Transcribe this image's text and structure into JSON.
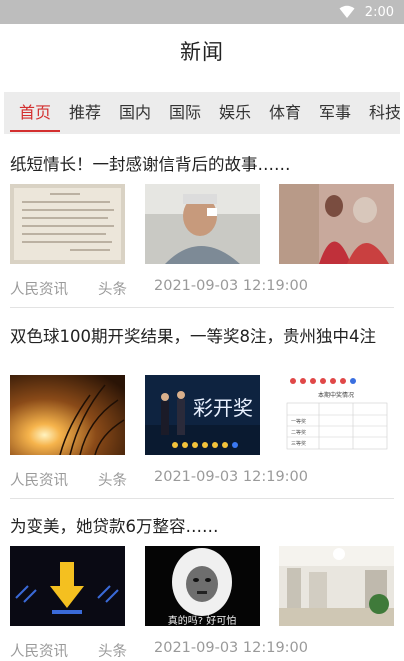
{
  "status_bar": {
    "time": "2:00"
  },
  "header": {
    "title": "新闻"
  },
  "tabs": [
    {
      "label": "首页"
    },
    {
      "label": "推荐"
    },
    {
      "label": "国内"
    },
    {
      "label": "国际"
    },
    {
      "label": "娱乐"
    },
    {
      "label": "体育"
    },
    {
      "label": "军事"
    },
    {
      "label": "科技"
    }
  ],
  "active_tab": "首页",
  "articles": [
    {
      "title": "纸短情长！一封感谢信背后的故事……",
      "source": "人民资讯",
      "category": "头条",
      "time": "2021-09-03 12:19:00"
    },
    {
      "title": "双色球100期开奖结果，一等奖8注，贵州独中4注",
      "source": "人民资讯",
      "category": "头条",
      "time": "2021-09-03 12:19:00",
      "thumb_text": "彩开奖",
      "table_title": "本期中奖情况",
      "table_rows": [
        "一等奖",
        "二等奖",
        "三等奖"
      ]
    },
    {
      "title": "为变美，她贷款6万整容……",
      "source": "人民资讯",
      "category": "头条",
      "time": "2021-09-03 12:19:00",
      "meme_text": "真的吗? 好可怕"
    }
  ],
  "colors": {
    "accent": "#d32f2f",
    "status_bar": "#bdbdbd",
    "tab_bar": "#ececec",
    "meta": "#9a9a9a"
  }
}
